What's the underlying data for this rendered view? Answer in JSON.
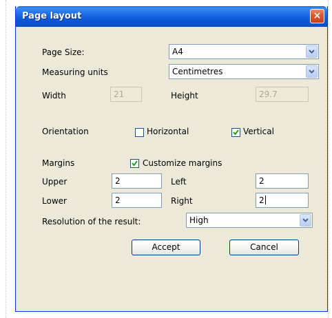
{
  "dialog": {
    "title": "Page layout",
    "close_label": "×"
  },
  "page_size": {
    "label": "Page Size:",
    "value": "A4"
  },
  "measuring_units": {
    "label": "Measuring units",
    "value": "Centimetres"
  },
  "width": {
    "label": "Width",
    "value": "21"
  },
  "height": {
    "label": "Height",
    "value": "29.7"
  },
  "orientation": {
    "label": "Orientation",
    "horizontal": {
      "label": "Horizontal",
      "checked": false
    },
    "vertical": {
      "label": "Vertical",
      "checked": true
    }
  },
  "margins": {
    "label": "Margins",
    "customize": {
      "label": "Customize margins",
      "checked": true
    },
    "upper": {
      "label": "Upper",
      "value": "2"
    },
    "left": {
      "label": "Left",
      "value": "2"
    },
    "lower": {
      "label": "Lower",
      "value": "2"
    },
    "right": {
      "label": "Right",
      "value": "2"
    }
  },
  "resolution": {
    "label": "Resolution of the result:",
    "value": "High"
  },
  "buttons": {
    "accept": "Accept",
    "cancel": "Cancel"
  },
  "colors": {
    "dialog_background": "#ece9d8",
    "titlebar_blue": "#0a57d6",
    "close_red": "#d9582f",
    "field_border": "#7f9db9",
    "check_green": "#21a121"
  }
}
